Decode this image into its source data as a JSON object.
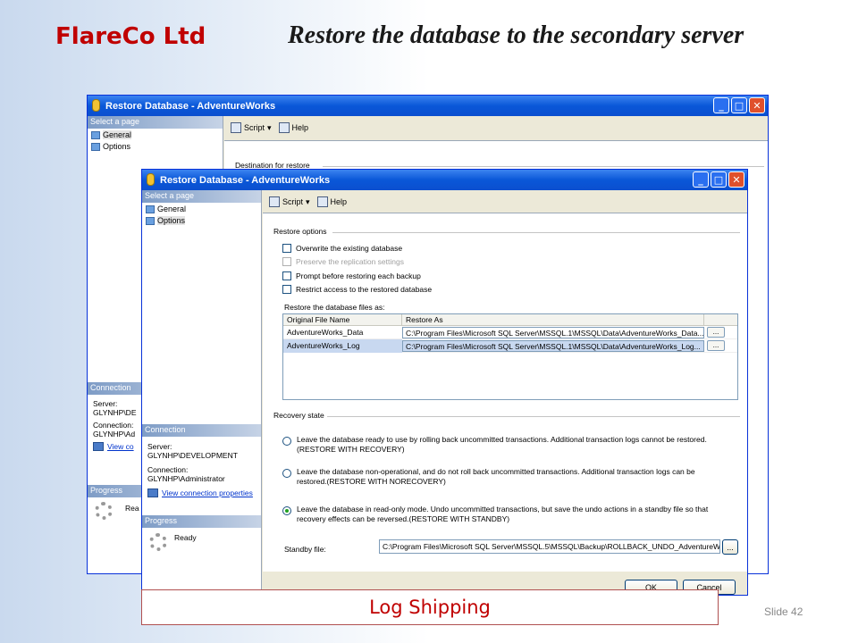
{
  "slide": {
    "brand": "FlareCo Ltd",
    "title": "Restore the database to the secondary server",
    "footer": "Log Shipping",
    "slide_number": "Slide 42"
  },
  "back_window": {
    "title": "Restore Database - AdventureWorks",
    "select_page": "Select a page",
    "pages": [
      "General",
      "Options"
    ],
    "script": "Script",
    "help": "Help",
    "destination_label": "Destination for restore",
    "connection_header": "Connection",
    "server_label": "Server:",
    "server_value": "GLYNHP\\DE",
    "connection_label": "Connection:",
    "connection_value": "GLYNHP\\Ad",
    "view_link": "View co",
    "progress_header": "Progress",
    "progress_status": "Rea"
  },
  "front_window": {
    "title": "Restore Database - AdventureWorks",
    "select_page": "Select a page",
    "pages": [
      "General",
      "Options"
    ],
    "script": "Script",
    "help": "Help",
    "restore_options_label": "Restore options",
    "options": [
      "Overwrite the existing database",
      "Preserve the replication settings",
      "Prompt before restoring each backup",
      "Restrict access to the restored database"
    ],
    "files_label": "Restore the database files as:",
    "col_original": "Original File Name",
    "col_restore": "Restore As",
    "files": [
      {
        "name": "AdventureWorks_Data",
        "path": "C:\\Program Files\\Microsoft SQL Server\\MSSQL.1\\MSSQL\\Data\\AdventureWorks_Data..."
      },
      {
        "name": "AdventureWorks_Log",
        "path": "C:\\Program Files\\Microsoft SQL Server\\MSSQL.1\\MSSQL\\Data\\AdventureWorks_Log..."
      }
    ],
    "browse_label": "...",
    "recovery_label": "Recovery state",
    "recovery_options": [
      "Leave the database ready to use by rolling back uncommitted transactions. Additional transaction logs cannot be restored.(RESTORE WITH RECOVERY)",
      "Leave the database non-operational, and do not roll back uncommitted transactions. Additional transaction logs can be restored.(RESTORE WITH NORECOVERY)",
      "Leave the database in read-only mode. Undo uncommitted transactions, but save the undo actions in a standby file so that recovery effects can be reversed.(RESTORE WITH STANDBY)"
    ],
    "standby_label": "Standby file:",
    "standby_value": "C:\\Program Files\\Microsoft SQL Server\\MSSQL.5\\MSSQL\\Backup\\ROLLBACK_UNDO_AdventureWo",
    "connection_header": "Connection",
    "server_label": "Server:",
    "server_value": "GLYNHP\\DEVELOPMENT",
    "connection_label": "Connection:",
    "connection_value": "GLYNHP\\Administrator",
    "view_link": "View connection properties",
    "progress_header": "Progress",
    "progress_status": "Ready",
    "ok": "OK",
    "cancel": "Cancel"
  }
}
